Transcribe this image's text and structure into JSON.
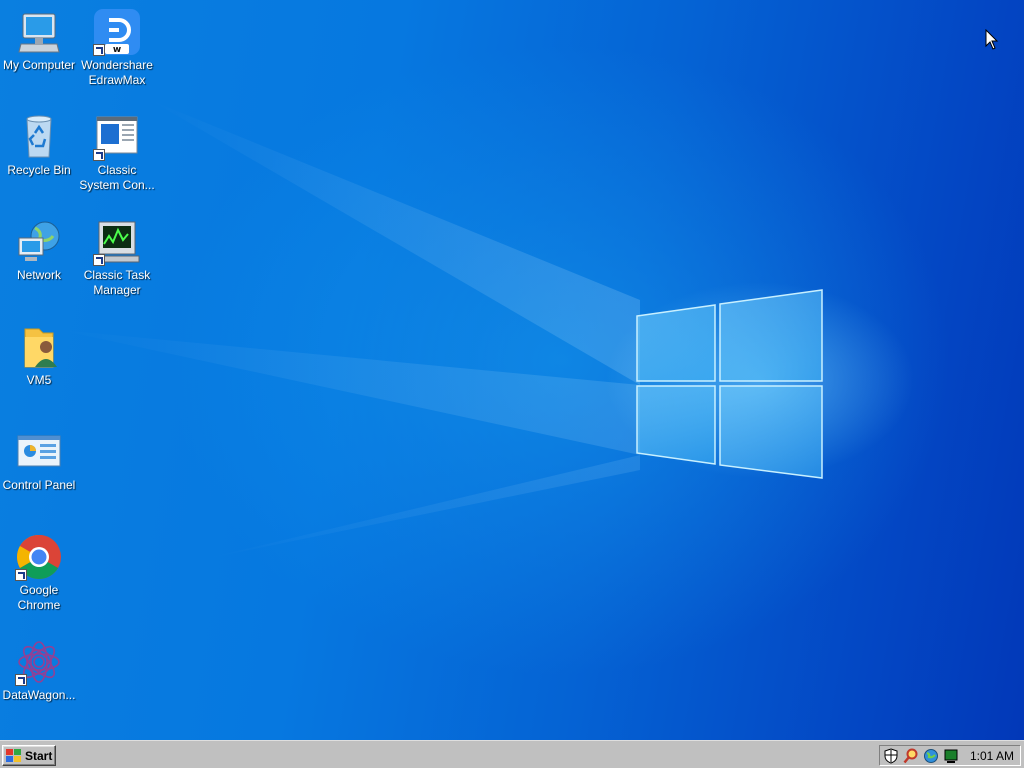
{
  "desktop": {
    "icons": [
      {
        "id": "my-computer",
        "label": "My Computer",
        "icon": "computer-icon",
        "shortcut": false
      },
      {
        "id": "edrawmax",
        "label": "Wondershare EdrawMax",
        "icon": "edrawmax-icon",
        "shortcut": true
      },
      {
        "id": "recycle-bin",
        "label": "Recycle Bin",
        "icon": "recycle-bin-icon",
        "shortcut": false
      },
      {
        "id": "classic-system-control",
        "label": "Classic System Con...",
        "icon": "system-control-icon",
        "shortcut": true
      },
      {
        "id": "network",
        "label": "Network",
        "icon": "network-icon",
        "shortcut": false
      },
      {
        "id": "classic-task-manager",
        "label": "Classic Task Manager",
        "icon": "task-manager-icon",
        "shortcut": true
      },
      {
        "id": "vm5",
        "label": "VM5",
        "icon": "user-folder-icon",
        "shortcut": false
      },
      {
        "id": "control-panel",
        "label": "Control Panel",
        "icon": "control-panel-icon",
        "shortcut": false
      },
      {
        "id": "google-chrome",
        "label": "Google Chrome",
        "icon": "chrome-icon",
        "shortcut": true
      },
      {
        "id": "datawagon",
        "label": "DataWagon...",
        "icon": "datawagon-icon",
        "shortcut": true
      }
    ]
  },
  "taskbar": {
    "start_label": "Start",
    "tray_icons": [
      "security-shield-icon",
      "search-magnifier-icon",
      "network-globe-icon",
      "monitor-icon"
    ],
    "clock": "1:01 AM"
  },
  "colors": {
    "desktop_blue": "#0678e0",
    "taskbar_gray": "#c0c0c0",
    "label_text": "#ffffff"
  }
}
